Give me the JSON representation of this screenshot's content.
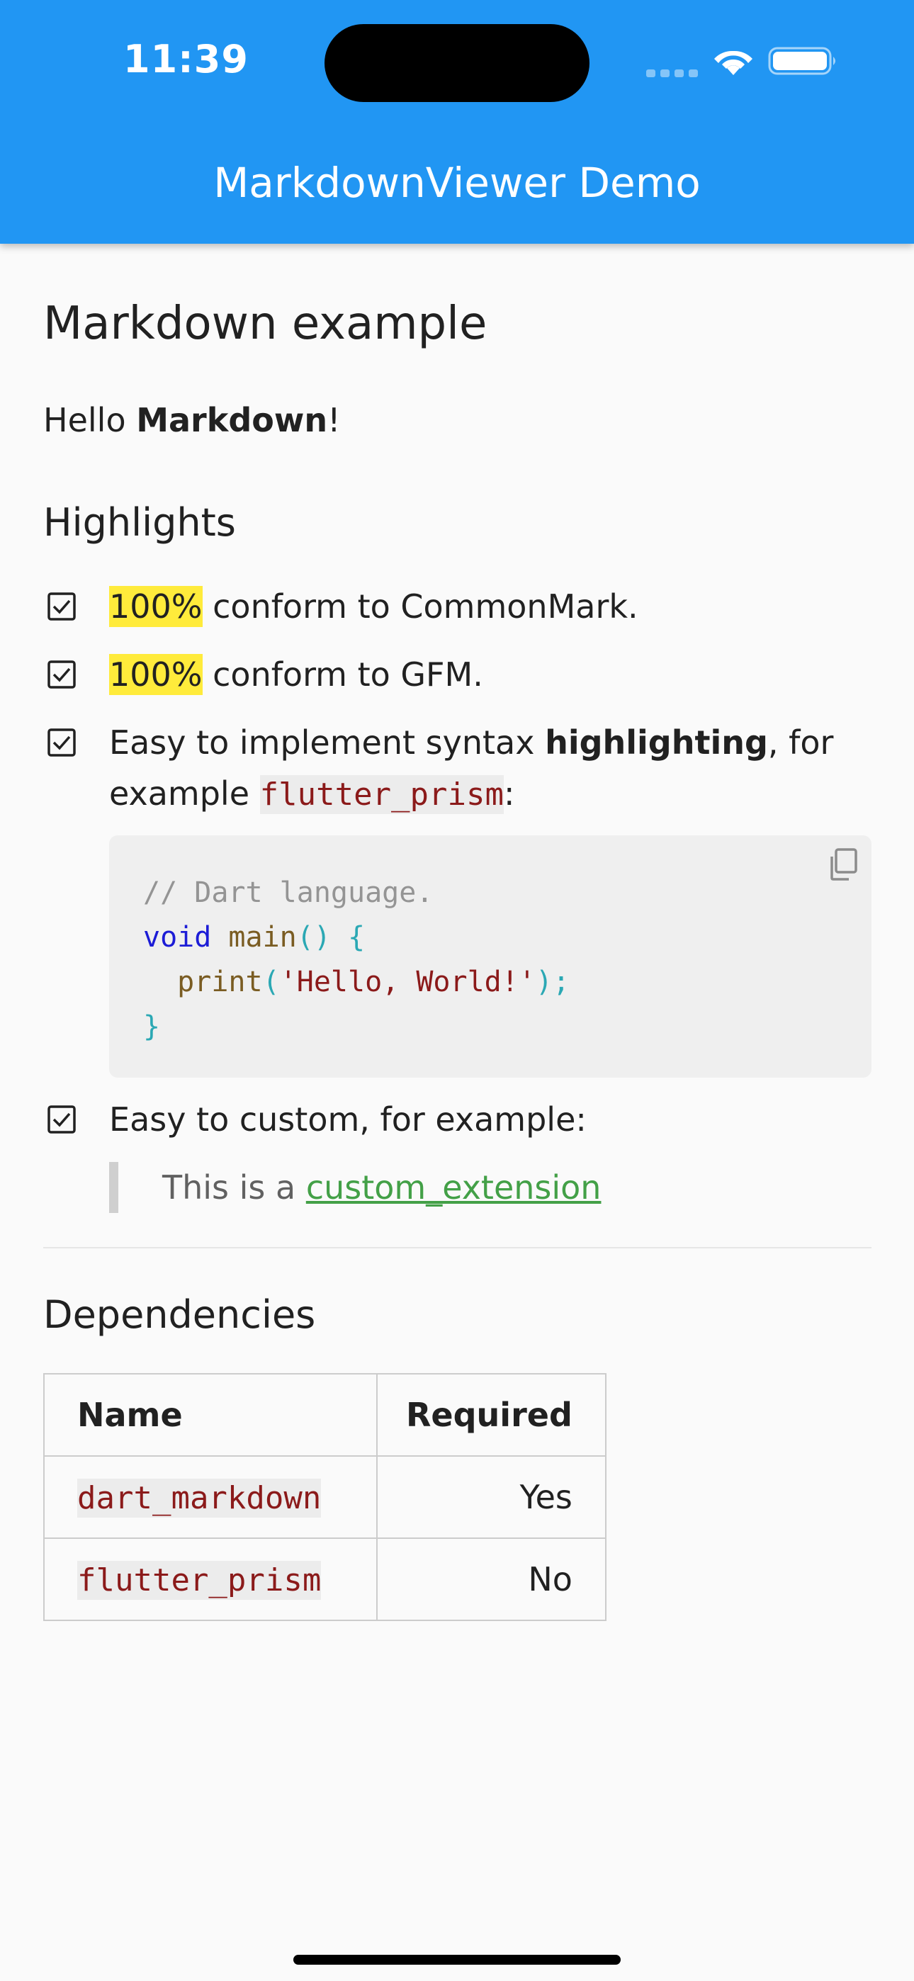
{
  "status_bar": {
    "time": "11:39"
  },
  "app_bar": {
    "title": "MarkdownViewer Demo",
    "color": "#2196f3"
  },
  "document": {
    "heading": "Markdown example",
    "intro": {
      "prefix": "Hello ",
      "bold": "Markdown",
      "suffix": "!"
    },
    "highlights": {
      "heading": "Highlights",
      "items": [
        {
          "checked": true,
          "mark": "100%",
          "text": " conform to CommonMark."
        },
        {
          "checked": true,
          "mark": "100%",
          "text": " conform to GFM."
        },
        {
          "checked": true,
          "line1_prefix": "Easy to implement syntax ",
          "line1_bold": "highlighting",
          "line1_suffix": ", for",
          "line2_prefix": "example ",
          "line2_code": "flutter_prism",
          "line2_suffix": ":"
        },
        {
          "checked": true,
          "text": "Easy to custom, for example:"
        }
      ]
    },
    "code_block": {
      "language": "Dart",
      "comment": "// Dart language.",
      "keyword": "void",
      "function": "main",
      "params": "()",
      "open_brace": "{",
      "print_indent": "  ",
      "print_fn": "print",
      "print_open": "(",
      "print_arg": "'Hello, World!'",
      "print_close": ");",
      "close_brace": "}"
    },
    "blockquote": {
      "prefix": "This is a ",
      "link": "custom_extension",
      "link_color": "#43a047"
    },
    "dependencies": {
      "heading": "Dependencies",
      "columns": [
        "Name",
        "Required"
      ],
      "rows": [
        {
          "name": "dart_markdown",
          "required": "Yes"
        },
        {
          "name": "flutter_prism",
          "required": "No"
        }
      ]
    }
  }
}
